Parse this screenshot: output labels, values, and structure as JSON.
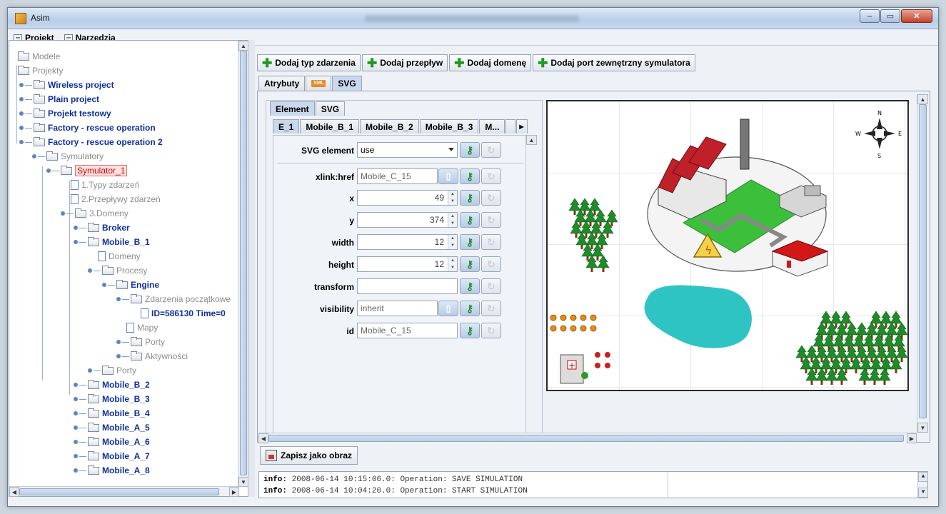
{
  "window": {
    "title": "Asim",
    "controls": {
      "minimize": "–",
      "maximize": "▭",
      "close": "✕"
    }
  },
  "menu": [
    {
      "label": "Projekt",
      "icon": "menu-icon"
    },
    {
      "label": "Narzędzia",
      "icon": "menu-icon"
    }
  ],
  "tree": {
    "modele": "Modele",
    "projekty": "Projekty",
    "projects": [
      "Wireless project",
      "Plain project",
      "Projekt testowy",
      "Factory - rescue operation",
      "Factory - rescue operation 2"
    ],
    "symulatory": "Symulatory",
    "symulator": "Symulator_1",
    "typy": "1.Typy zdarzeń",
    "przeplywy": "2.Przepływy zdarzeń",
    "domeny": "3.Domeny",
    "broker": "Broker",
    "mobile_b_1": "Mobile_B_1",
    "sub_domeny": "Domeny",
    "procesy": "Procesy",
    "engine": "Engine",
    "zdarzenia": "Zdarzenia początkowe",
    "event_id": "ID=586130 Time=0",
    "mapy": "Mapy",
    "porty_inner": "Porty",
    "aktywnosci": "Aktywności",
    "porty": "Porty",
    "mobiles": [
      "Mobile_B_2",
      "Mobile_B_3",
      "Mobile_B_4",
      "Mobile_A_5",
      "Mobile_A_6",
      "Mobile_A_7",
      "Mobile_A_8"
    ]
  },
  "toolbar": {
    "add_event_type": "Dodaj typ zdarzenia",
    "add_flow": "Dodaj przepływ",
    "add_domain": "Dodaj domenę",
    "add_port": "Dodaj port zewnętrzny symulatora"
  },
  "main_tabs": {
    "attributes": "Atrybuty",
    "xml": "XML",
    "svg": "SVG"
  },
  "inner_tabs": {
    "element": "Element",
    "svg": "SVG"
  },
  "element_tabs": [
    "E_1",
    "Mobile_B_1",
    "Mobile_B_2",
    "Mobile_B_3",
    "M..."
  ],
  "form": {
    "svg_element_label": "SVG element",
    "svg_element_value": "use",
    "xlink_label": "xlink:href",
    "xlink_value": "Mobile_C_15",
    "x_label": "x",
    "x_value": "49",
    "y_label": "y",
    "y_value": "374",
    "width_label": "width",
    "width_value": "12",
    "height_label": "height",
    "height_value": "12",
    "transform_label": "transform",
    "transform_value": "",
    "visibility_label": "visibility",
    "visibility_value": "inherit",
    "id_label": "id",
    "id_value": "Mobile_C_15"
  },
  "map": {
    "compass": {
      "n": "N",
      "s": "S",
      "e": "E",
      "w": "W"
    }
  },
  "save_button": "Zapisz jako obraz",
  "log": [
    {
      "level": "info:",
      "text": "2008-06-14 10:15:06.0: Operation: SAVE SIMULATION"
    },
    {
      "level": "info:",
      "text": "2008-06-14 10:04:20.0: Operation: START SIMULATION"
    }
  ],
  "colors": {
    "accent": "#0f2f9e",
    "selected": "#dd0000",
    "add_icon": "#1c9a1c",
    "grass": "#3cc03c",
    "lake": "#2ec4c4",
    "roof": "#c0202a"
  }
}
